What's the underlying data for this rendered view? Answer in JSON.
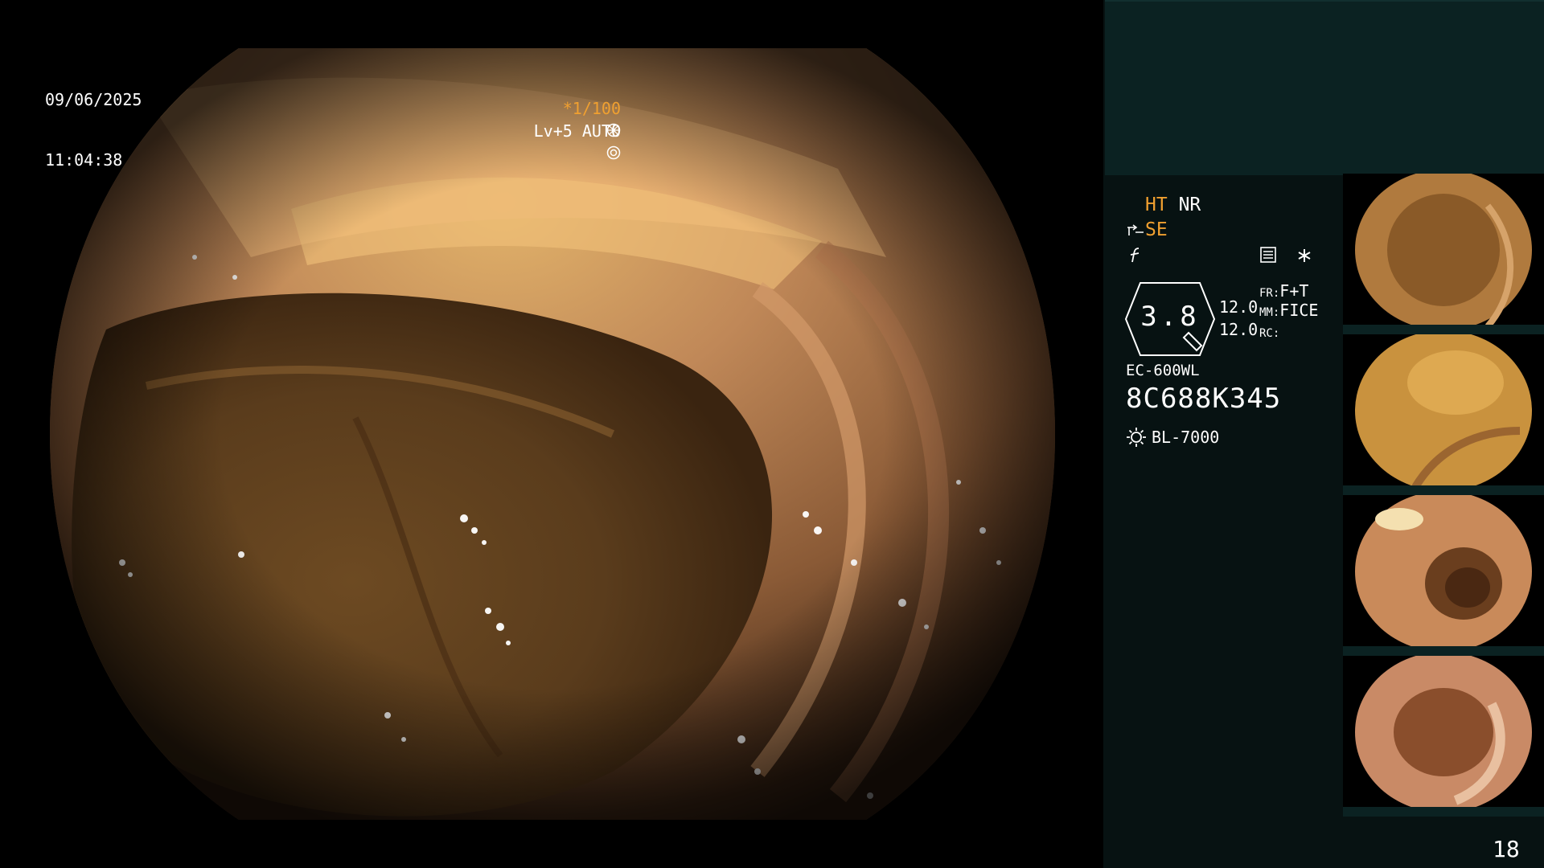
{
  "overlay": {
    "date": "09/06/2025",
    "time": "11:04:38",
    "shutter": "*1/100",
    "level": "Lv+5 AUTO"
  },
  "status": {
    "ht": "HT",
    "nr": "NR",
    "se": "SE",
    "fr_label": "FR:",
    "fr_value": "F+T",
    "mm_label": "MM:",
    "mm_value": "FICE",
    "rc_label": "RC:",
    "zoom": "3.8",
    "zoom_value_1": "12.0",
    "zoom_value_2": "12.0"
  },
  "scope": {
    "model": "EC-600WL",
    "serial": "8C688K345",
    "light_source": "BL-7000"
  },
  "thumbnails": [
    {
      "icon": "endoscopy-thumbnail-1"
    },
    {
      "icon": "endoscopy-thumbnail-2"
    },
    {
      "icon": "endoscopy-thumbnail-3"
    },
    {
      "icon": "endoscopy-thumbnail-4"
    }
  ],
  "page_number": "18",
  "colors": {
    "accent": "#f0a030",
    "panel_top": "#0b2222",
    "panel": "#071212"
  }
}
